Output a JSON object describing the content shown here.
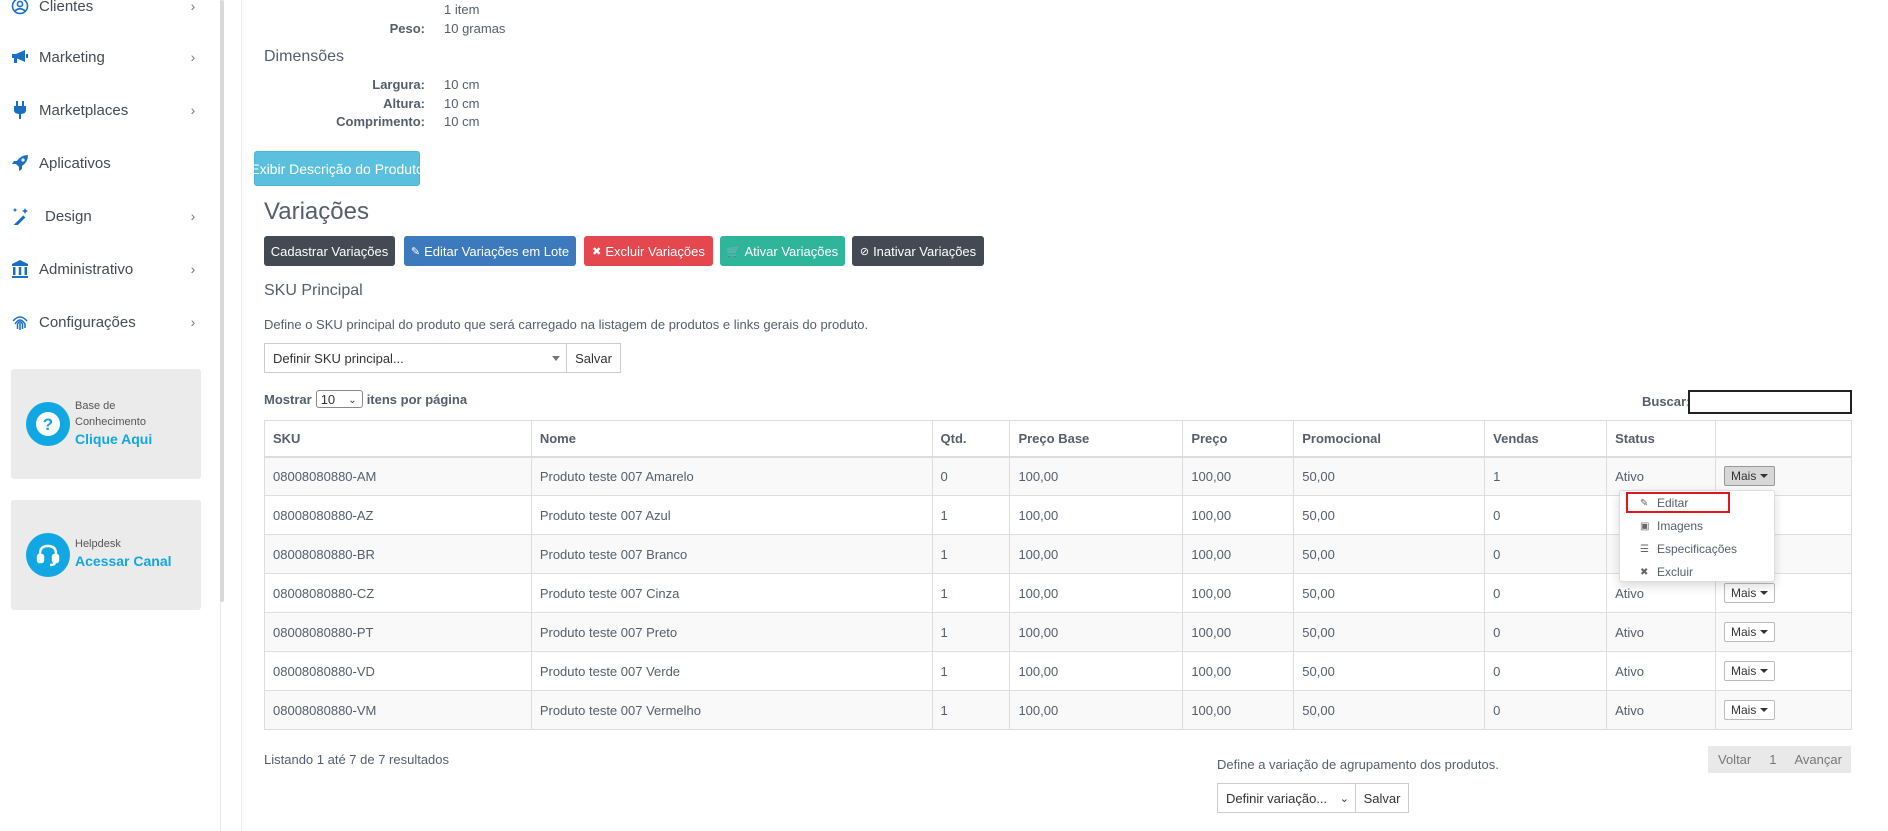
{
  "sidebar": {
    "items": [
      {
        "label": "Clientes",
        "icon": "user-circle-icon"
      },
      {
        "label": "Marketing",
        "icon": "megaphone-icon"
      },
      {
        "label": "Marketplaces",
        "icon": "plug-icon"
      },
      {
        "label": "Aplicativos",
        "icon": "rocket-icon"
      },
      {
        "label": "Design",
        "icon": "magic-wand-icon"
      },
      {
        "label": "Administrativo",
        "icon": "building-icon"
      },
      {
        "label": "Configurações",
        "icon": "fingerprint-icon"
      }
    ],
    "knowledge": {
      "small": "Base de Conhecimento",
      "link": "Clique Aqui"
    },
    "helpdesk": {
      "small": "Helpdesk",
      "link": "Acessar Canal"
    }
  },
  "product": {
    "items_value": "1 item",
    "peso_label": "Peso:",
    "peso_value": "10 gramas",
    "dim_title": "Dimensões",
    "largura_label": "Largura:",
    "largura_value": "10 cm",
    "altura_label": "Altura:",
    "altura_value": "10 cm",
    "comprimento_label": "Comprimento:",
    "comprimento_value": "10 cm",
    "desc_button": "Exibir Descrição do Produto"
  },
  "variacoes": {
    "title": "Variações",
    "buttons": {
      "cadastrar": "Cadastrar Variações",
      "editar_lote": "Editar Variações em Lote",
      "excluir": "Excluir Variações",
      "ativar": "Ativar Variações",
      "inativar": "Inativar Variações"
    },
    "colors": {
      "dark": "#434a54",
      "blue": "#3c79bd",
      "red": "#e4474d",
      "green": "#2fb69a",
      "info": "#5bc0de"
    }
  },
  "sku": {
    "title": "SKU Principal",
    "description": "Define o SKU principal do produto que será carregado na listagem de produtos e links gerais do produto.",
    "select_value": "Definir SKU principal...",
    "save": "Salvar"
  },
  "table_controls": {
    "show_label": "Mostrar",
    "per_page": "10",
    "per_page_suffix": "itens por página",
    "search_label": "Buscar:"
  },
  "table": {
    "headers": [
      "SKU",
      "Nome",
      "Qtd.",
      "Preço Base",
      "Preço",
      "Promocional",
      "Vendas",
      "Status",
      ""
    ],
    "rows": [
      {
        "sku": "08008080880-AM",
        "nome": "Produto teste 007 Amarelo",
        "qtd": "0",
        "base": "100,00",
        "preco": "100,00",
        "promo": "50,00",
        "vendas": "1",
        "status": "Ativo",
        "action": "Mais"
      },
      {
        "sku": "08008080880-AZ",
        "nome": "Produto teste 007 Azul",
        "qtd": "1",
        "base": "100,00",
        "preco": "100,00",
        "promo": "50,00",
        "vendas": "0",
        "status": "",
        "action": ""
      },
      {
        "sku": "08008080880-BR",
        "nome": "Produto teste 007 Branco",
        "qtd": "1",
        "base": "100,00",
        "preco": "100,00",
        "promo": "50,00",
        "vendas": "0",
        "status": "",
        "action": ""
      },
      {
        "sku": "08008080880-CZ",
        "nome": "Produto teste 007 Cinza",
        "qtd": "1",
        "base": "100,00",
        "preco": "100,00",
        "promo": "50,00",
        "vendas": "0",
        "status": "Ativo",
        "action": "Mais"
      },
      {
        "sku": "08008080880-PT",
        "nome": "Produto teste 007 Preto",
        "qtd": "1",
        "base": "100,00",
        "preco": "100,00",
        "promo": "50,00",
        "vendas": "0",
        "status": "Ativo",
        "action": "Mais"
      },
      {
        "sku": "08008080880-VD",
        "nome": "Produto teste 007 Verde",
        "qtd": "1",
        "base": "100,00",
        "preco": "100,00",
        "promo": "50,00",
        "vendas": "0",
        "status": "Ativo",
        "action": "Mais"
      },
      {
        "sku": "08008080880-VM",
        "nome": "Produto teste 007 Vermelho",
        "qtd": "1",
        "base": "100,00",
        "preco": "100,00",
        "promo": "50,00",
        "vendas": "0",
        "status": "Ativo",
        "action": "Mais"
      }
    ]
  },
  "dropdown": {
    "items": [
      {
        "label": "Editar",
        "icon": "edit-icon"
      },
      {
        "label": "Imagens",
        "icon": "image-icon"
      },
      {
        "label": "Especificações",
        "icon": "list-icon"
      },
      {
        "label": "Excluir",
        "icon": "x-icon"
      }
    ]
  },
  "footer": {
    "listing": "Listando 1 até 7 de 7 resultados",
    "group_desc": "Define a variação de agrupamento dos produtos.",
    "group_select": "Definir variação...",
    "group_save": "Salvar",
    "pager": {
      "prev": "Voltar",
      "page": "1",
      "next": "Avançar"
    }
  }
}
